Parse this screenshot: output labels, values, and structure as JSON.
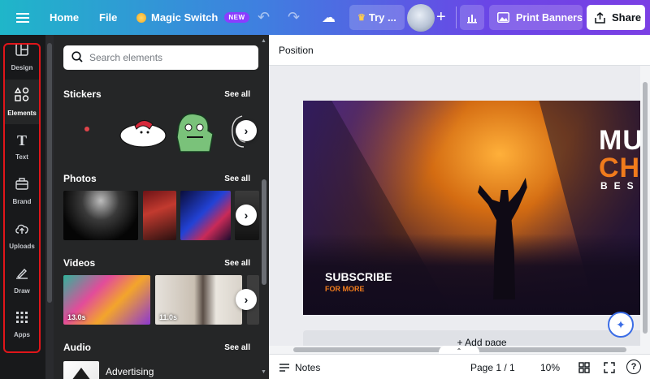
{
  "topbar": {
    "home": "Home",
    "file": "File",
    "magic_switch": "Magic Switch",
    "new_badge": "NEW",
    "try_label": "Try ...",
    "print_banners": "Print Banners",
    "share": "Share"
  },
  "rail": {
    "items": [
      {
        "label": "Design",
        "icon": "layout-icon"
      },
      {
        "label": "Elements",
        "icon": "shapes-icon"
      },
      {
        "label": "Text",
        "icon": "text-icon"
      },
      {
        "label": "Brand",
        "icon": "brand-icon"
      },
      {
        "label": "Uploads",
        "icon": "cloud-upload-icon"
      },
      {
        "label": "Draw",
        "icon": "pen-icon"
      },
      {
        "label": "Apps",
        "icon": "grid-icon"
      }
    ],
    "active": "Elements"
  },
  "panel": {
    "search_placeholder": "Search elements",
    "sections": {
      "stickers": "Stickers",
      "photos": "Photos",
      "videos": "Videos",
      "audio": "Audio"
    },
    "see_all": "See all",
    "video_durations": [
      "13.0s",
      "11.0s"
    ],
    "audio_first_track": "Advertising"
  },
  "canvas": {
    "toolbar_label": "Position",
    "design": {
      "headline_1": "MUS",
      "headline_2": "CHA",
      "headline_3": "BES",
      "subscribe": "SUBSCRIBE",
      "for_more": "FOR MORE"
    },
    "add_page": "+ Add page"
  },
  "bottombar": {
    "notes": "Notes",
    "page": "Page 1 / 1",
    "zoom": "10%"
  },
  "colors": {
    "brand_purple": "#8b3dff",
    "rail_bg": "#18191b",
    "panel_bg": "#252627",
    "highlight_red": "#e0151a",
    "accent_orange": "#f17b1c"
  }
}
